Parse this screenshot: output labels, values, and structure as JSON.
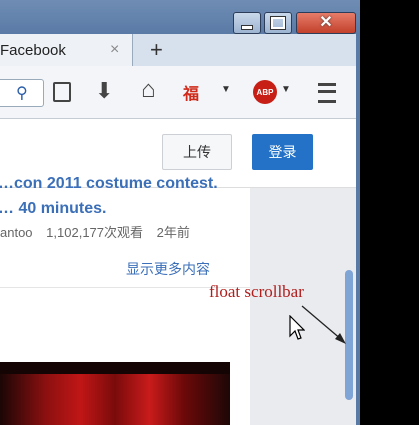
{
  "browser": {
    "tab": {
      "title": "Facebook",
      "close": "×"
    },
    "new_tab": "+",
    "window_controls": {
      "close": "✕"
    },
    "toolbar": {
      "search_icon": "⚲",
      "download_icon": "⬇",
      "home_icon": "⌂",
      "extension_glyph": "福",
      "dropdown_glyph": "▼",
      "abp_label": "ABP"
    }
  },
  "page": {
    "header": {
      "upload_label": "上传",
      "login_label": "登录"
    },
    "video": {
      "title_line1": "…con 2011 costume contest.",
      "title_line2": "… 40 minutes.",
      "author": "antoo",
      "views": "1,102,177次观看",
      "age": "2年前"
    },
    "show_more": "显示更多内容"
  },
  "annotation": {
    "label": "float scrollbar"
  },
  "colors": {
    "link_blue": "#3b6fb8",
    "login_blue": "#2472c8",
    "annotation_red": "#b01e1e",
    "scroll_thumb": "#7fa4d6"
  },
  "icons": [
    "search-icon",
    "reader-view-icon",
    "download-icon",
    "home-icon",
    "fu-extension-icon",
    "adblock-plus-icon",
    "hamburger-menu-icon",
    "mouse-cursor-icon",
    "arrow-icon"
  ]
}
